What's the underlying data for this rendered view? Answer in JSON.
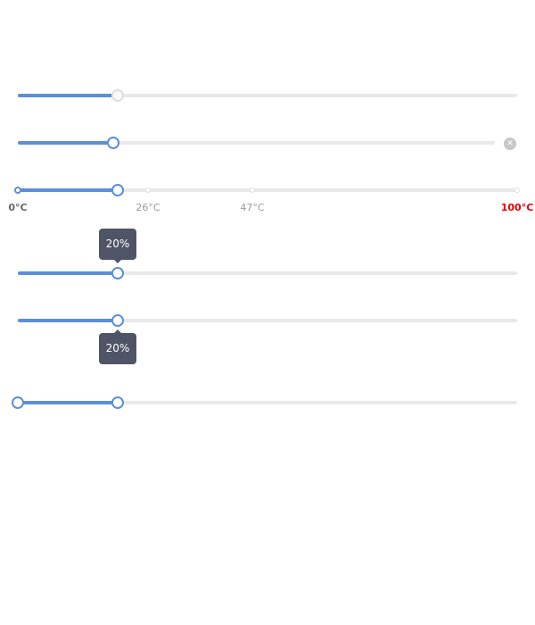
{
  "colors": {
    "track": "#5b8fd9",
    "rail": "#e9e9e9",
    "tooltip_bg": "#4f5566",
    "max_label": "#e60000",
    "disabled_handle": "#dedede"
  },
  "sliders": [
    {
      "id": "disabled",
      "value": 20,
      "disabled": true
    },
    {
      "id": "clearable",
      "value": 20,
      "clear_icon": "close-icon"
    },
    {
      "id": "marks",
      "value": 20,
      "marks": [
        {
          "value": 0,
          "label": "0°C"
        },
        {
          "value": 26,
          "label": "26°C"
        },
        {
          "value": 47,
          "label": "47°C"
        },
        {
          "value": 100,
          "label": "100°C"
        }
      ]
    },
    {
      "id": "tooltip-top",
      "value": 20,
      "tooltip": "20%"
    },
    {
      "id": "tooltip-bottom",
      "value": 20,
      "tooltip": "20%"
    },
    {
      "id": "range",
      "range": [
        0,
        20
      ]
    }
  ]
}
